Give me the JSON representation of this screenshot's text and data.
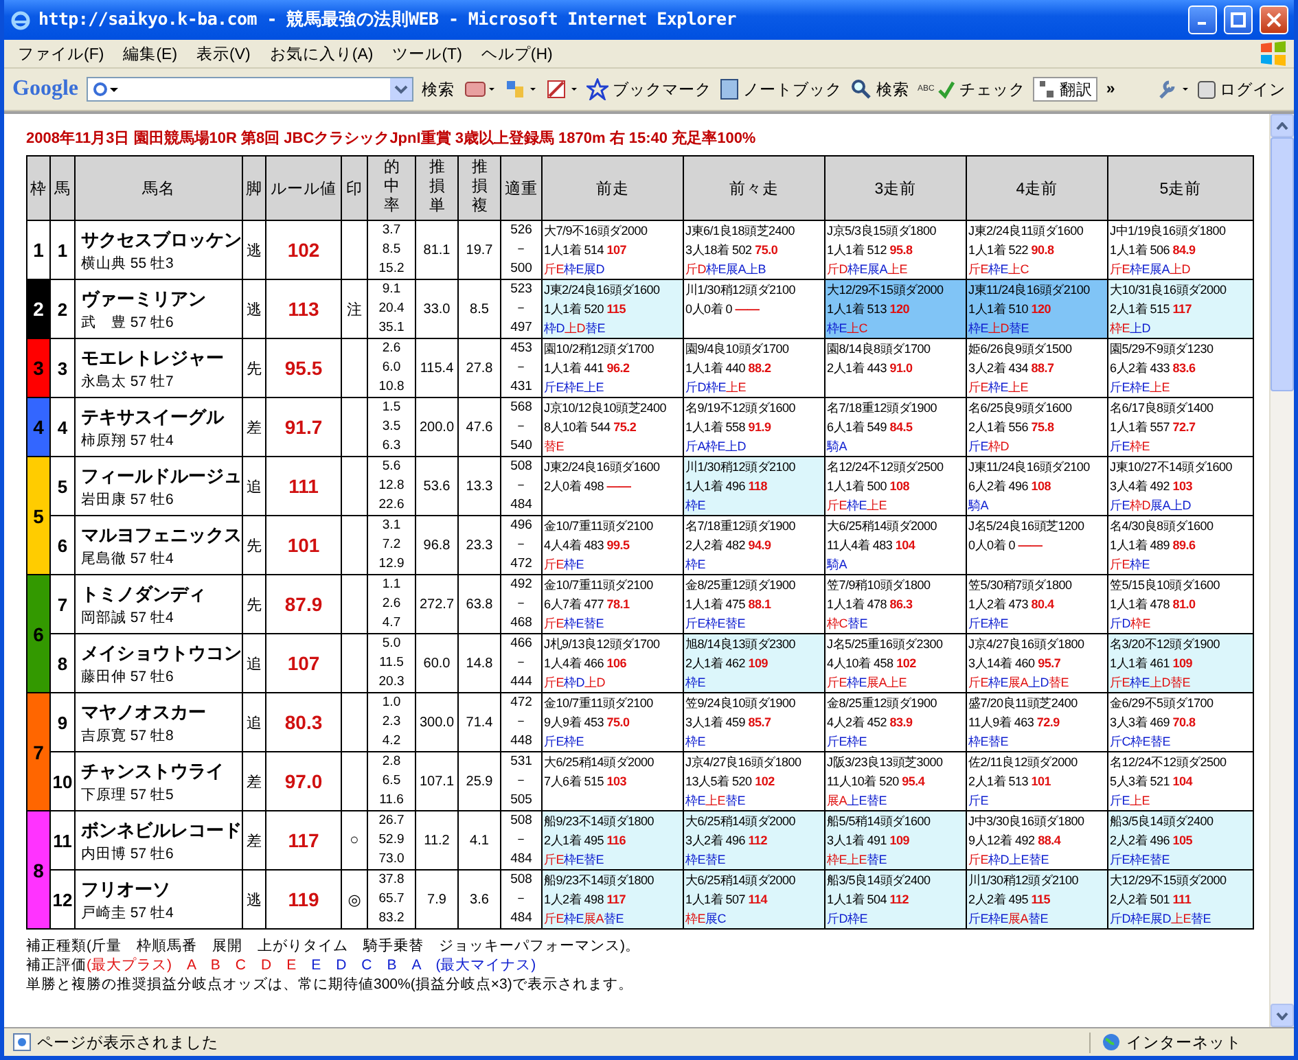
{
  "window": {
    "title": "http://saikyo.k-ba.com - 競馬最強の法則WEB - Microsoft Internet Explorer"
  },
  "menu": [
    "ファイル(F)",
    "編集(E)",
    "表示(V)",
    "お気に入り(A)",
    "ツール(T)",
    "ヘルプ(H)"
  ],
  "toolbar": {
    "logo": "Google",
    "search_button": "検索",
    "bookmark": "ブックマーク",
    "notebook": "ノートブック",
    "search": "検索",
    "check_icon_text": "ABC",
    "check": "チェック",
    "translate": "翻訳",
    "more": "»",
    "login": "ログイン"
  },
  "page_title": "2008年11月3日 園田競馬場10R 第8回 JBCクラシックJpnI重賞 3歳以上登録馬 1870m 右 15:40 充足率100%",
  "table": {
    "columns": [
      "枠",
      "馬",
      "馬名",
      "脚",
      "ルール値",
      "印",
      "的中率",
      "推損単",
      "推損複",
      "適重",
      "前走",
      "前々走",
      "3走前",
      "4走前",
      "5走前"
    ],
    "frames": [
      {
        "label": "1",
        "color": "#ffffff",
        "horses": [
          {
            "number": "1",
            "name": "サクセスブロッケン",
            "jockey": "横山典 55 牡3",
            "style": "逃",
            "rule_value": "102",
            "hit_rates": [
              "3.7",
              "8.5",
              "15.2"
            ],
            "win_odds": "81.1",
            "place_odds": "19.7",
            "weights": [
              "526",
              "－",
              "500"
            ],
            "races": [
              {
                "info": "大7/9不16頭ダ2000",
                "result": "1人1着 514",
                "score": "107",
                "highlighted": false,
                "best": false,
                "tags": [
                  {
                    "label": "斤E",
                    "plus": true
                  },
                  {
                    "label": "枠E",
                    "plus": false
                  },
                  {
                    "label": "展D",
                    "plus": false
                  }
                ]
              },
              {
                "info": "J東6/1良18頭芝2400",
                "result": "3人18着 502",
                "score": "75.0",
                "highlighted": false,
                "best": false,
                "tags": [
                  {
                    "label": "斤D",
                    "plus": true
                  },
                  {
                    "label": "枠E",
                    "plus": false
                  },
                  {
                    "label": "展A",
                    "plus": false
                  },
                  {
                    "label": "上B",
                    "plus": false
                  }
                ]
              },
              {
                "info": "J京5/3良15頭ダ1800",
                "result": "1人1着 512",
                "score": "95.8",
                "highlighted": false,
                "best": false,
                "tags": [
                  {
                    "label": "斤D",
                    "plus": true
                  },
                  {
                    "label": "枠E",
                    "plus": false
                  },
                  {
                    "label": "展A",
                    "plus": false
                  },
                  {
                    "label": "上E",
                    "plus": true
                  }
                ]
              },
              {
                "info": "J東2/24良11頭ダ1600",
                "result": "1人1着 522",
                "score": "90.8",
                "highlighted": false,
                "best": false,
                "tags": [
                  {
                    "label": "斤E",
                    "plus": true
                  },
                  {
                    "label": "枠E",
                    "plus": false
                  },
                  {
                    "label": "上C",
                    "plus": true
                  }
                ]
              },
              {
                "info": "J中1/19良16頭ダ1800",
                "result": "1人1着 506",
                "score": "84.9",
                "highlighted": false,
                "best": false,
                "tags": [
                  {
                    "label": "斤E",
                    "plus": true
                  },
                  {
                    "label": "枠E",
                    "plus": false
                  },
                  {
                    "label": "展A",
                    "plus": false
                  },
                  {
                    "label": "上D",
                    "plus": true
                  }
                ]
              }
            ]
          }
        ]
      },
      {
        "label": "2",
        "color": "#000000",
        "horses": [
          {
            "number": "2",
            "name": "ヴァーミリアン",
            "jockey": "武　豊 57 牡6",
            "style": "逃",
            "rule_value": "113",
            "mark": "注",
            "hit_rates": [
              "9.1",
              "20.4",
              "35.1"
            ],
            "win_odds": "33.0",
            "place_odds": "8.5",
            "weights": [
              "523",
              "－",
              "497"
            ],
            "races": [
              {
                "info": "J東2/24良16頭ダ1600",
                "result": "1人1着 520",
                "score": "115",
                "highlighted": true,
                "best": false,
                "tags": [
                  {
                    "label": "枠D",
                    "plus": false
                  },
                  {
                    "label": "上D",
                    "plus": true
                  },
                  {
                    "label": "替E",
                    "plus": false
                  }
                ]
              },
              {
                "info": "川1/30稍12頭ダ2100",
                "result": "0人0着 0",
                "score": "——",
                "highlighted": false,
                "best": false
              },
              {
                "info": "大12/29不15頭ダ2000",
                "result": "1人1着 513",
                "score": "120",
                "highlighted": true,
                "best": true,
                "tags": [
                  {
                    "label": "枠E",
                    "plus": false
                  },
                  {
                    "label": "上C",
                    "plus": true
                  }
                ]
              },
              {
                "info": "J東11/24良16頭ダ2100",
                "result": "1人1着 510",
                "score": "120",
                "highlighted": true,
                "best": true,
                "tags": [
                  {
                    "label": "枠E",
                    "plus": false
                  },
                  {
                    "label": "上D",
                    "plus": true
                  },
                  {
                    "label": "替E",
                    "plus": false
                  }
                ]
              },
              {
                "info": "大10/31良16頭ダ2000",
                "result": "2人1着 515",
                "score": "117",
                "highlighted": true,
                "best": false,
                "tags": [
                  {
                    "label": "枠E",
                    "plus": true
                  },
                  {
                    "label": "上D",
                    "plus": false
                  }
                ]
              }
            ]
          }
        ]
      },
      {
        "label": "3",
        "color": "#ff0000",
        "horses": [
          {
            "number": "3",
            "name": "モエレトレジャー",
            "jockey": "永島太 57 牡7",
            "style": "先",
            "rule_value": "95.5",
            "hit_rates": [
              "2.6",
              "6.0",
              "10.8"
            ],
            "win_odds": "115.4",
            "place_odds": "27.8",
            "weights": [
              "453",
              "－",
              "431"
            ],
            "races": [
              {
                "info": "園10/2稍12頭ダ1700",
                "result": "1人1着 441",
                "score": "96.2",
                "highlighted": false,
                "best": false,
                "tags": [
                  {
                    "label": "斤E",
                    "plus": false
                  },
                  {
                    "label": "枠E",
                    "plus": false
                  },
                  {
                    "label": "上E",
                    "plus": false
                  }
                ]
              },
              {
                "info": "園9/4良10頭ダ1700",
                "result": "1人1着 440",
                "score": "88.2",
                "highlighted": false,
                "best": false,
                "tags": [
                  {
                    "label": "斤D",
                    "plus": false
                  },
                  {
                    "label": "枠E",
                    "plus": false
                  },
                  {
                    "label": "上E",
                    "plus": true
                  }
                ]
              },
              {
                "info": "園8/14良8頭ダ1700",
                "result": "2人1着 443",
                "score": "91.0",
                "highlighted": false,
                "best": false
              },
              {
                "info": "姫6/26良9頭ダ1500",
                "result": "3人2着 434",
                "score": "88.7",
                "highlighted": false,
                "best": false,
                "tags": [
                  {
                    "label": "斤E",
                    "plus": true
                  },
                  {
                    "label": "枠E",
                    "plus": false
                  },
                  {
                    "label": "上E",
                    "plus": true
                  }
                ]
              },
              {
                "info": "園5/29不9頭ダ1230",
                "result": "6人2着 433",
                "score": "83.6",
                "highlighted": false,
                "best": false,
                "tags": [
                  {
                    "label": "斤E",
                    "plus": false
                  },
                  {
                    "label": "枠E",
                    "plus": false
                  },
                  {
                    "label": "上E",
                    "plus": true
                  }
                ]
              }
            ]
          }
        ]
      },
      {
        "label": "4",
        "color": "#3366ff",
        "horses": [
          {
            "number": "4",
            "name": "テキサスイーグル",
            "jockey": "柿原翔 57 牡4",
            "style": "差",
            "rule_value": "91.7",
            "hit_rates": [
              "1.5",
              "3.5",
              "6.3"
            ],
            "win_odds": "200.0",
            "place_odds": "47.6",
            "weights": [
              "568",
              "－",
              "540"
            ],
            "races": [
              {
                "info": "J京10/12良10頭芝2400",
                "result": "8人10着 544",
                "score": "75.2",
                "highlighted": false,
                "best": false,
                "tags": [
                  {
                    "label": "替E",
                    "plus": true
                  }
                ]
              },
              {
                "info": "名9/19不12頭ダ1600",
                "result": "1人1着 558",
                "score": "91.9",
                "highlighted": false,
                "best": false,
                "tags": [
                  {
                    "label": "斤A",
                    "plus": false
                  },
                  {
                    "label": "枠E",
                    "plus": false
                  },
                  {
                    "label": "上D",
                    "plus": false
                  }
                ]
              },
              {
                "info": "名7/18重12頭ダ1900",
                "result": "6人1着 549",
                "score": "84.5",
                "highlighted": false,
                "best": false,
                "tags": [
                  {
                    "label": "騎A",
                    "plus": false
                  }
                ]
              },
              {
                "info": "名6/25良9頭ダ1600",
                "result": "2人1着 556",
                "score": "75.8",
                "highlighted": false,
                "best": false,
                "tags": [
                  {
                    "label": "斤E",
                    "plus": false
                  },
                  {
                    "label": "枠D",
                    "plus": true
                  }
                ]
              },
              {
                "info": "名6/17良8頭ダ1400",
                "result": "1人1着 557",
                "score": "72.7",
                "highlighted": false,
                "best": false,
                "tags": [
                  {
                    "label": "斤E",
                    "plus": false
                  },
                  {
                    "label": "枠E",
                    "plus": true
                  }
                ]
              }
            ]
          }
        ]
      },
      {
        "label": "5",
        "color": "#ffcc00",
        "horses": [
          {
            "number": "5",
            "name": "フィールドルージュ",
            "jockey": "岩田康 57 牡6",
            "style": "追",
            "rule_value": "111",
            "hit_rates": [
              "5.6",
              "12.8",
              "22.6"
            ],
            "win_odds": "53.6",
            "place_odds": "13.3",
            "weights": [
              "508",
              "－",
              "484"
            ],
            "races": [
              {
                "info": "J東2/24良16頭ダ1600",
                "result": "2人0着 498",
                "score": "——",
                "highlighted": false,
                "best": false
              },
              {
                "info": "川1/30稍12頭ダ2100",
                "result": "1人1着 496",
                "score": "118",
                "highlighted": true,
                "best": false,
                "tags": [
                  {
                    "label": "枠E",
                    "plus": false
                  }
                ]
              },
              {
                "info": "名12/24不12頭ダ2500",
                "result": "1人1着 500",
                "score": "108",
                "highlighted": false,
                "best": false,
                "tags": [
                  {
                    "label": "斤E",
                    "plus": true
                  },
                  {
                    "label": "枠E",
                    "plus": false
                  },
                  {
                    "label": "上E",
                    "plus": true
                  }
                ]
              },
              {
                "info": "J東11/24良16頭ダ2100",
                "result": "6人2着 496",
                "score": "108",
                "highlighted": false,
                "best": false,
                "tags": [
                  {
                    "label": "騎A",
                    "plus": false
                  }
                ]
              },
              {
                "info": "J東10/27不14頭ダ1600",
                "result": "3人4着 492",
                "score": "103",
                "highlighted": false,
                "best": false,
                "tags": [
                  {
                    "label": "斤E",
                    "plus": false
                  },
                  {
                    "label": "枠D",
                    "plus": true
                  },
                  {
                    "label": "展A",
                    "plus": false
                  },
                  {
                    "label": "上D",
                    "plus": false
                  }
                ]
              }
            ]
          },
          {
            "number": "6",
            "name": "マルヨフェニックス",
            "jockey": "尾島徹 57 牡4",
            "style": "先",
            "rule_value": "101",
            "hit_rates": [
              "3.1",
              "7.2",
              "12.9"
            ],
            "win_odds": "96.8",
            "place_odds": "23.3",
            "weights": [
              "496",
              "－",
              "472"
            ],
            "races": [
              {
                "info": "金10/7重11頭ダ2100",
                "result": "4人4着 483",
                "score": "99.5",
                "highlighted": false,
                "best": false,
                "tags": [
                  {
                    "label": "斤E",
                    "plus": true
                  },
                  {
                    "label": "枠E",
                    "plus": false
                  }
                ]
              },
              {
                "info": "名7/18重12頭ダ1900",
                "result": "2人2着 482",
                "score": "94.9",
                "highlighted": false,
                "best": false,
                "tags": [
                  {
                    "label": "枠E",
                    "plus": false
                  }
                ]
              },
              {
                "info": "大6/25稍14頭ダ2000",
                "result": "11人4着 483",
                "score": "104",
                "highlighted": false,
                "best": false,
                "tags": [
                  {
                    "label": "騎A",
                    "plus": false
                  }
                ]
              },
              {
                "info": "J名5/24良16頭芝1200",
                "result": "0人0着 0",
                "score": "——",
                "highlighted": false,
                "best": false
              },
              {
                "info": "名4/30良8頭ダ1600",
                "result": "1人1着 489",
                "score": "89.6",
                "highlighted": false,
                "best": false,
                "tags": [
                  {
                    "label": "斤E",
                    "plus": true
                  },
                  {
                    "label": "枠E",
                    "plus": false
                  }
                ]
              }
            ]
          }
        ]
      },
      {
        "label": "6",
        "color": "#339900",
        "horses": [
          {
            "number": "7",
            "name": "トミノダンディ",
            "jockey": "岡部誠 57 牡4",
            "style": "先",
            "rule_value": "87.9",
            "hit_rates": [
              "1.1",
              "2.6",
              "4.7"
            ],
            "win_odds": "272.7",
            "place_odds": "63.8",
            "weights": [
              "492",
              "－",
              "468"
            ],
            "races": [
              {
                "info": "金10/7重11頭ダ2100",
                "result": "6人7着 477",
                "score": "78.1",
                "highlighted": false,
                "best": false,
                "tags": [
                  {
                    "label": "斤E",
                    "plus": true
                  },
                  {
                    "label": "枠E",
                    "plus": false
                  },
                  {
                    "label": "替E",
                    "plus": false
                  }
                ]
              },
              {
                "info": "金8/25重12頭ダ1900",
                "result": "1人1着 475",
                "score": "88.1",
                "highlighted": false,
                "best": false,
                "tags": [
                  {
                    "label": "斤E",
                    "plus": false
                  },
                  {
                    "label": "枠E",
                    "plus": false
                  },
                  {
                    "label": "替E",
                    "plus": false
                  }
                ]
              },
              {
                "info": "笠7/9稍10頭ダ1800",
                "result": "1人1着 478",
                "score": "86.3",
                "highlighted": false,
                "best": false,
                "tags": [
                  {
                    "label": "枠C",
                    "plus": true
                  },
                  {
                    "label": "替E",
                    "plus": false
                  }
                ]
              },
              {
                "info": "笠5/30稍7頭ダ1800",
                "result": "1人2着 473",
                "score": "80.4",
                "highlighted": false,
                "best": false,
                "tags": [
                  {
                    "label": "斤E",
                    "plus": false
                  },
                  {
                    "label": "枠E",
                    "plus": false
                  }
                ]
              },
              {
                "info": "笠5/15良10頭ダ1600",
                "result": "1人1着 478",
                "score": "81.0",
                "highlighted": false,
                "best": false,
                "tags": [
                  {
                    "label": "斤D",
                    "plus": false
                  },
                  {
                    "label": "枠E",
                    "plus": true
                  }
                ]
              }
            ]
          },
          {
            "number": "8",
            "name": "メイショウトウコン",
            "jockey": "藤田伸 57 牡6",
            "style": "追",
            "rule_value": "107",
            "hit_rates": [
              "5.0",
              "11.5",
              "20.3"
            ],
            "win_odds": "60.0",
            "place_odds": "14.8",
            "weights": [
              "466",
              "－",
              "444"
            ],
            "races": [
              {
                "info": "J札9/13良12頭ダ1700",
                "result": "1人4着 466",
                "score": "106",
                "highlighted": false,
                "best": false,
                "tags": [
                  {
                    "label": "斤E",
                    "plus": true
                  },
                  {
                    "label": "枠D",
                    "plus": false
                  },
                  {
                    "label": "上D",
                    "plus": true
                  }
                ]
              },
              {
                "info": "旭8/14良13頭ダ2300",
                "result": "2人1着 462",
                "score": "109",
                "highlighted": true,
                "best": false,
                "tags": [
                  {
                    "label": "枠E",
                    "plus": false
                  }
                ]
              },
              {
                "info": "J名5/25重16頭ダ2300",
                "result": "4人10着 458",
                "score": "102",
                "highlighted": false,
                "best": false,
                "tags": [
                  {
                    "label": "斤E",
                    "plus": true
                  },
                  {
                    "label": "枠E",
                    "plus": false
                  },
                  {
                    "label": "展A",
                    "plus": true
                  },
                  {
                    "label": "上E",
                    "plus": true
                  }
                ]
              },
              {
                "info": "J京4/27良16頭ダ1800",
                "result": "3人14着 460",
                "score": "95.7",
                "highlighted": false,
                "best": false,
                "tags": [
                  {
                    "label": "斤E",
                    "plus": true
                  },
                  {
                    "label": "枠E",
                    "plus": false
                  },
                  {
                    "label": "展A",
                    "plus": true
                  },
                  {
                    "label": "上D",
                    "plus": false
                  },
                  {
                    "label": "替E",
                    "plus": true
                  }
                ]
              },
              {
                "info": "名3/20不12頭ダ1900",
                "result": "1人1着 461",
                "score": "109",
                "highlighted": true,
                "best": false,
                "tags": [
                  {
                    "label": "斤E",
                    "plus": true
                  },
                  {
                    "label": "枠E",
                    "plus": false
                  },
                  {
                    "label": "上D",
                    "plus": true
                  },
                  {
                    "label": "替E",
                    "plus": true
                  }
                ]
              }
            ]
          }
        ]
      },
      {
        "label": "7",
        "color": "#ff6600",
        "horses": [
          {
            "number": "9",
            "name": "マヤノオスカー",
            "jockey": "吉原寛 57 牡8",
            "style": "追",
            "rule_value": "80.3",
            "hit_rates": [
              "1.0",
              "2.3",
              "4.2"
            ],
            "win_odds": "300.0",
            "place_odds": "71.4",
            "weights": [
              "472",
              "－",
              "448"
            ],
            "races": [
              {
                "info": "金10/7重11頭ダ2100",
                "result": "9人9着 453",
                "score": "75.0",
                "highlighted": false,
                "best": false,
                "tags": [
                  {
                    "label": "斤E",
                    "plus": false
                  },
                  {
                    "label": "枠E",
                    "plus": false
                  }
                ]
              },
              {
                "info": "笠9/24良10頭ダ1900",
                "result": "3人1着 459",
                "score": "85.7",
                "highlighted": false,
                "best": false,
                "tags": [
                  {
                    "label": "枠E",
                    "plus": false
                  }
                ]
              },
              {
                "info": "金8/25重12頭ダ1900",
                "result": "4人2着 452",
                "score": "83.9",
                "highlighted": false,
                "best": false,
                "tags": [
                  {
                    "label": "斤E",
                    "plus": false
                  },
                  {
                    "label": "枠E",
                    "plus": false
                  }
                ]
              },
              {
                "info": "盛7/20良11頭芝2400",
                "result": "11人9着 463",
                "score": "72.9",
                "highlighted": false,
                "best": false,
                "tags": [
                  {
                    "label": "枠E",
                    "plus": false
                  },
                  {
                    "label": "替E",
                    "plus": false
                  }
                ]
              },
              {
                "info": "金6/29不5頭ダ1700",
                "result": "3人3着 469",
                "score": "70.8",
                "highlighted": false,
                "best": false,
                "tags": [
                  {
                    "label": "斤C",
                    "plus": false
                  },
                  {
                    "label": "枠E",
                    "plus": false
                  },
                  {
                    "label": "替E",
                    "plus": false
                  }
                ]
              }
            ]
          },
          {
            "number": "10",
            "name": "チャンストウライ",
            "jockey": "下原理 57 牡5",
            "style": "差",
            "rule_value": "97.0",
            "hit_rates": [
              "2.8",
              "6.5",
              "11.6"
            ],
            "win_odds": "107.1",
            "place_odds": "25.9",
            "weights": [
              "531",
              "－",
              "505"
            ],
            "races": [
              {
                "info": "大6/25稍14頭ダ2000",
                "result": "7人6着 515",
                "score": "103",
                "highlighted": false,
                "best": false
              },
              {
                "info": "J京4/27良16頭ダ1800",
                "result": "13人5着 520",
                "score": "102",
                "highlighted": false,
                "best": false,
                "tags": [
                  {
                    "label": "枠E",
                    "plus": false
                  },
                  {
                    "label": "上E",
                    "plus": true
                  },
                  {
                    "label": "替E",
                    "plus": false
                  }
                ]
              },
              {
                "info": "J阪3/23良13頭芝3000",
                "result": "11人10着 520",
                "score": "95.4",
                "highlighted": false,
                "best": false,
                "tags": [
                  {
                    "label": "展A",
                    "plus": true
                  },
                  {
                    "label": "上E",
                    "plus": false
                  },
                  {
                    "label": "替E",
                    "plus": false
                  }
                ]
              },
              {
                "info": "佐2/11良12頭ダ2000",
                "result": "2人1着 513",
                "score": "101",
                "highlighted": false,
                "best": false,
                "tags": [
                  {
                    "label": "斤E",
                    "plus": false
                  }
                ]
              },
              {
                "info": "名12/24不12頭ダ2500",
                "result": "5人3着 521",
                "score": "104",
                "highlighted": false,
                "best": false,
                "tags": [
                  {
                    "label": "斤E",
                    "plus": false
                  },
                  {
                    "label": "上E",
                    "plus": true
                  }
                ]
              }
            ]
          }
        ]
      },
      {
        "label": "8",
        "color": "#ff33ff",
        "horses": [
          {
            "number": "11",
            "name": "ボンネビルレコード",
            "jockey": "内田博 57 牡6",
            "style": "差",
            "rule_value": "117",
            "mark": "○",
            "hit_rates": [
              "26.7",
              "52.9",
              "73.0"
            ],
            "win_odds": "11.2",
            "place_odds": "4.1",
            "weights": [
              "508",
              "－",
              "484"
            ],
            "races": [
              {
                "info": "船9/23不14頭ダ1800",
                "result": "2人1着 495",
                "score": "116",
                "highlighted": true,
                "best": false,
                "tags": [
                  {
                    "label": "斤E",
                    "plus": true
                  },
                  {
                    "label": "枠E",
                    "plus": false
                  },
                  {
                    "label": "替E",
                    "plus": false
                  }
                ]
              },
              {
                "info": "大6/25稍14頭ダ2000",
                "result": "3人2着 496",
                "score": "112",
                "highlighted": true,
                "best": false,
                "tags": [
                  {
                    "label": "枠E",
                    "plus": false
                  },
                  {
                    "label": "替E",
                    "plus": false
                  }
                ]
              },
              {
                "info": "船5/5稍14頭ダ1600",
                "result": "3人1着 491",
                "score": "109",
                "highlighted": true,
                "best": false,
                "tags": [
                  {
                    "label": "枠E",
                    "plus": true
                  },
                  {
                    "label": "上E",
                    "plus": true
                  },
                  {
                    "label": "替E",
                    "plus": false
                  }
                ]
              },
              {
                "info": "J中3/30良16頭ダ1800",
                "result": "9人12着 492",
                "score": "88.4",
                "highlighted": false,
                "best": false,
                "tags": [
                  {
                    "label": "斤E",
                    "plus": true
                  },
                  {
                    "label": "枠D",
                    "plus": false
                  },
                  {
                    "label": "上E",
                    "plus": false
                  },
                  {
                    "label": "替E",
                    "plus": false
                  }
                ]
              },
              {
                "info": "船3/5良14頭ダ2400",
                "result": "2人2着 496",
                "score": "105",
                "highlighted": true,
                "best": false,
                "tags": [
                  {
                    "label": "斤E",
                    "plus": false
                  },
                  {
                    "label": "枠E",
                    "plus": false
                  },
                  {
                    "label": "替E",
                    "plus": false
                  }
                ]
              }
            ]
          },
          {
            "number": "12",
            "name": "フリオーソ",
            "jockey": "戸崎圭 57 牡4",
            "style": "逃",
            "rule_value": "119",
            "mark": "◎",
            "hit_rates": [
              "37.8",
              "65.7",
              "83.2"
            ],
            "win_odds": "7.9",
            "place_odds": "3.6",
            "weights": [
              "508",
              "－",
              "484"
            ],
            "races": [
              {
                "info": "船9/23不14頭ダ1800",
                "result": "1人2着 498",
                "score": "117",
                "highlighted": true,
                "best": false,
                "tags": [
                  {
                    "label": "斤E",
                    "plus": true
                  },
                  {
                    "label": "枠E",
                    "plus": false
                  },
                  {
                    "label": "展A",
                    "plus": true
                  },
                  {
                    "label": "替E",
                    "plus": false
                  }
                ]
              },
              {
                "info": "大6/25稍14頭ダ2000",
                "result": "1人1着 507",
                "score": "114",
                "highlighted": true,
                "best": false,
                "tags": [
                  {
                    "label": "枠E",
                    "plus": true
                  },
                  {
                    "label": "展C",
                    "plus": false
                  }
                ]
              },
              {
                "info": "船3/5良14頭ダ2400",
                "result": "1人1着 504",
                "score": "112",
                "highlighted": true,
                "best": false,
                "tags": [
                  {
                    "label": "斤D",
                    "plus": false
                  },
                  {
                    "label": "枠E",
                    "plus": false
                  }
                ]
              },
              {
                "info": "川1/30稍12頭ダ2100",
                "result": "2人2着 495",
                "score": "115",
                "highlighted": true,
                "best": false,
                "tags": [
                  {
                    "label": "斤E",
                    "plus": false
                  },
                  {
                    "label": "枠E",
                    "plus": false
                  },
                  {
                    "label": "展A",
                    "plus": true
                  },
                  {
                    "label": "替E",
                    "plus": false
                  }
                ]
              },
              {
                "info": "大12/29不15頭ダ2000",
                "result": "2人2着 501",
                "score": "111",
                "highlighted": true,
                "best": false,
                "tags": [
                  {
                    "label": "斤D",
                    "plus": false
                  },
                  {
                    "label": "枠E",
                    "plus": false
                  },
                  {
                    "label": "展D",
                    "plus": false
                  },
                  {
                    "label": "上E",
                    "plus": true
                  },
                  {
                    "label": "替E",
                    "plus": false
                  }
                ]
              }
            ]
          }
        ]
      }
    ]
  },
  "notes": {
    "types": "補正種類(斤量　枠順馬番　展開　上がりタイム　騎手乗替　ジョッキーパフォーマンス)。",
    "legend_label": "補正評価",
    "legend_plus": "(最大プラス)　A　B　C　D　E",
    "legend_minus": "E　D　C　B　A　(最大マイナス)",
    "odds": "単勝と複勝の推奨損益分岐点オッズは、常に期待値300%(損益分岐点×3)で表示されます。"
  },
  "status_bar": {
    "message": "ページが表示されました",
    "zone": "インターネット"
  }
}
